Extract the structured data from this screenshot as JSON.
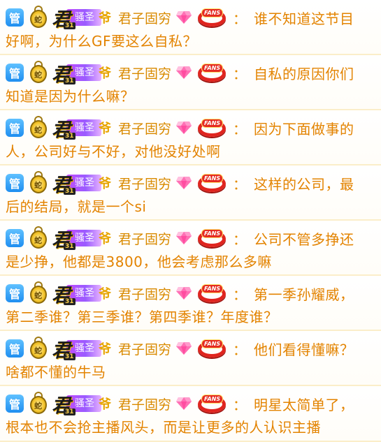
{
  "user": {
    "admin_badge": "管",
    "medal_glyph": "蛇",
    "level_char": "君",
    "level_number": "31",
    "title_label": "骚圣",
    "title_mark": "爷",
    "name": "君子固穷",
    "fans_label": "FANS",
    "colon": "："
  },
  "icons": [
    "admin-badge-icon",
    "gold-medal-icon",
    "level-badge-icon",
    "diamond-gem-icon",
    "fans-ring-icon"
  ],
  "colors": {
    "text": "#e38300",
    "admin": "#1f8ef0",
    "title": "#9a5bff",
    "fans": "#e0251f"
  },
  "messages": [
    {
      "line1": "谁不知道这节目",
      "line2": "好啊，为什么GF要这么自私？"
    },
    {
      "line1": "自私的原因你们",
      "line2": "知道是因为什么嘛？"
    },
    {
      "line1": "因为下面做事的",
      "line2": "人，公司好与不好，对他没好处啊"
    },
    {
      "line1": "这样的公司，最",
      "line2": "后的结局，就是一个si"
    },
    {
      "line1": "公司不管多挣还",
      "line2": "是少挣，他都是3800，他会考虑那么多嘛"
    },
    {
      "line1": "第一季孙耀威，",
      "line2": "第二季谁？第三季谁？第四季谁？年度谁？"
    },
    {
      "line1": "他们看得懂嘛？",
      "line2": "啥都不懂的牛马"
    },
    {
      "line1": "明星太简单了，",
      "line2": "根本也不会抢主播风头，而是让更多的人认识主播"
    }
  ]
}
